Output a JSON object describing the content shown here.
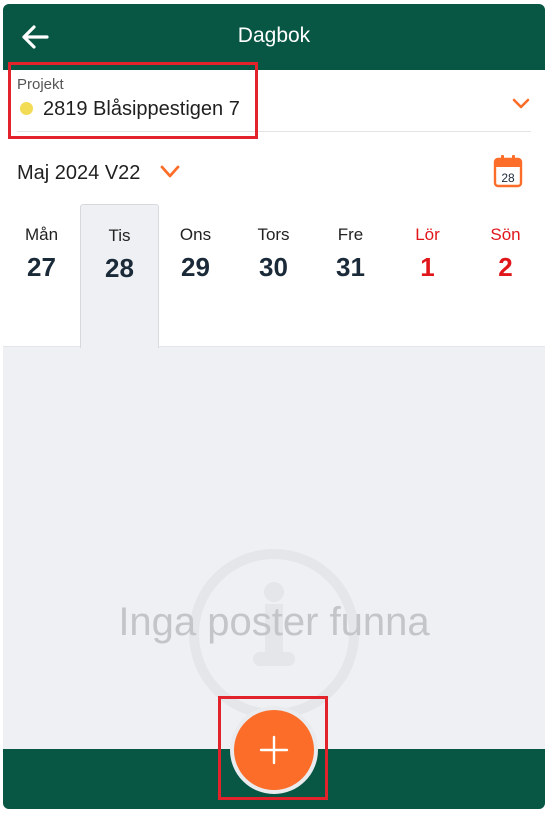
{
  "header": {
    "title": "Dagbok",
    "back_icon": "arrow-left-icon"
  },
  "project": {
    "label": "Projekt",
    "name": "2819 Blåsippestigen 7",
    "status_color": "#f2dc55"
  },
  "period": {
    "label": "Maj 2024 V22",
    "calendar_day": "28"
  },
  "week": {
    "days": [
      {
        "name": "Mån",
        "num": "27",
        "weekend": false,
        "selected": false
      },
      {
        "name": "Tis",
        "num": "28",
        "weekend": false,
        "selected": true
      },
      {
        "name": "Ons",
        "num": "29",
        "weekend": false,
        "selected": false
      },
      {
        "name": "Tors",
        "num": "30",
        "weekend": false,
        "selected": false
      },
      {
        "name": "Fre",
        "num": "31",
        "weekend": false,
        "selected": false
      },
      {
        "name": "Lör",
        "num": "1",
        "weekend": true,
        "selected": false
      },
      {
        "name": "Sön",
        "num": "2",
        "weekend": true,
        "selected": false
      }
    ]
  },
  "empty_state": {
    "message": "Inga poster funna",
    "icon": "info-icon"
  },
  "fab": {
    "icon": "plus-icon"
  },
  "colors": {
    "brand_green": "#075744",
    "accent_orange": "#fb6d28",
    "weekend_red": "#e0161b",
    "highlight_red": "#e3232b"
  }
}
